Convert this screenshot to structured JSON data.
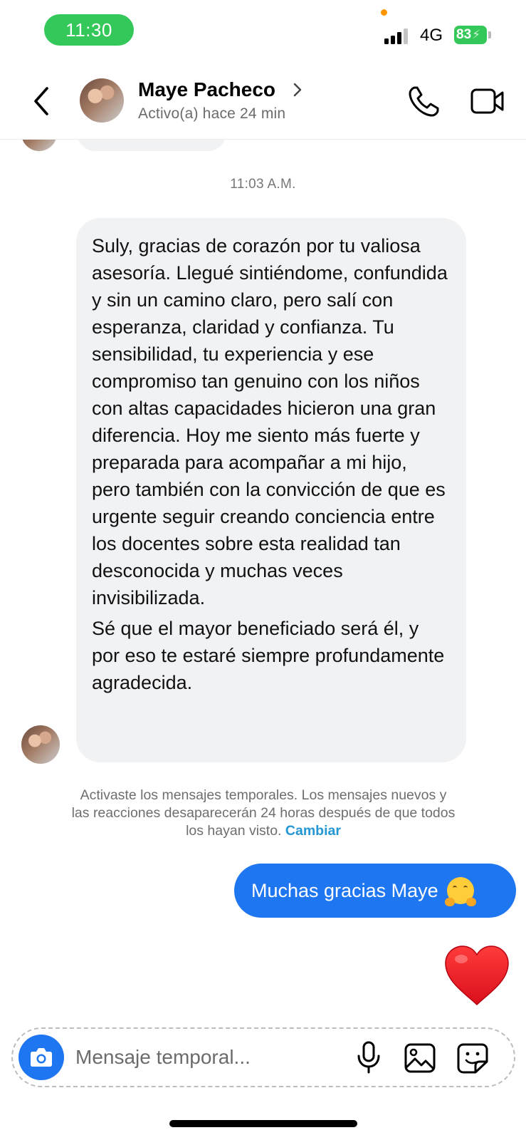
{
  "status_bar": {
    "time": "11:30",
    "network": "4G",
    "battery": "83",
    "colors": {
      "time_pill": "#34c759",
      "battery": "#34c759",
      "privacy_dot": "#ff9500"
    }
  },
  "header": {
    "contact_name": "Maye Pacheco",
    "status": "Activo(a) hace 24 min",
    "icons": [
      "back-chevron-icon",
      "chevron-right-icon",
      "phone-icon",
      "video-camera-icon"
    ]
  },
  "chat": {
    "timestamp": "11:03 A.M.",
    "received_message": {
      "paragraphs": [
        "Suly, gracias de corazón por tu valiosa asesoría. Llegué sintiéndome, confundida y sin un camino claro, pero salí con esperanza, claridad y confianza. Tu sensibilidad, tu experiencia y ese compromiso tan genuino con los niños con altas capacidades hicieron una gran diferencia. Hoy me siento más fuerte y preparada para acompañar a mi hijo, pero también con la convicción de que es urgente seguir creando conciencia entre los docentes sobre esta realidad tan desconocida y muchas veces invisibilizada.",
        "Sé que el mayor beneficiado será él, y por eso te estaré siempre profundamente agradecida."
      ],
      "bubble_color": "#f1f2f4"
    },
    "system_note": {
      "text": "Activaste los mensajes temporales. Los mensajes nuevos y las reacciones desaparecerán 24 horas después de que todos los hayan visto.",
      "link": "Cambiar",
      "link_color": "#2397d3"
    },
    "sent_message": {
      "text": "Muchas gracias Maye",
      "emoji": "hugging-face-emoji",
      "bubble_color": "#1e76f1"
    },
    "sent_reaction": "red-heart-emoji"
  },
  "composer": {
    "placeholder": "Mensaje temporal...",
    "value": "",
    "icons": [
      "camera-icon",
      "microphone-icon",
      "gallery-icon",
      "sticker-icon"
    ]
  }
}
